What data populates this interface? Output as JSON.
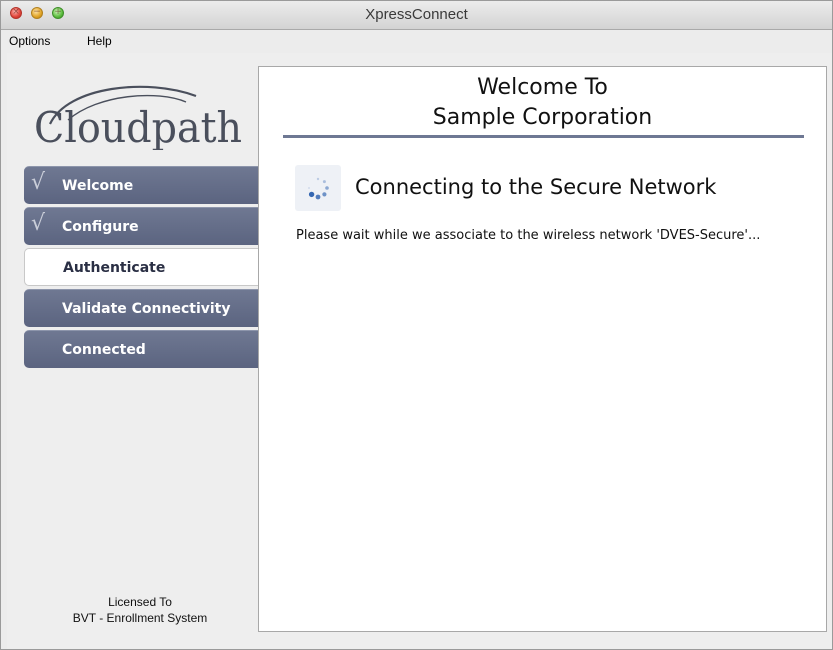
{
  "window": {
    "title": "XpressConnect",
    "controls": {
      "close_icon": "close-icon",
      "minimize_icon": "minimize-icon",
      "maximize_icon": "maximize-icon"
    }
  },
  "menu": {
    "items": [
      {
        "label": "Options"
      },
      {
        "label": "Help"
      }
    ]
  },
  "branding": {
    "logo_text": "Cloudpath"
  },
  "steps": [
    {
      "label": "Welcome",
      "status": "completed",
      "icon": "checkmark-icon"
    },
    {
      "label": "Configure",
      "status": "completed",
      "icon": "checkmark-icon"
    },
    {
      "label": "Authenticate",
      "status": "active",
      "icon": ""
    },
    {
      "label": "Validate Connectivity",
      "status": "pending",
      "icon": ""
    },
    {
      "label": "Connected",
      "status": "pending",
      "icon": ""
    }
  ],
  "license": {
    "line1": "Licensed To",
    "line2": "BVT - Enrollment System"
  },
  "content": {
    "title_line1": "Welcome To",
    "title_line2": "Sample Corporation",
    "status_icon": "loading-spinner-icon",
    "status_heading": "Connecting to the Secure Network",
    "status_text": "Please wait while we associate to the wireless network 'DVES-Secure'..."
  },
  "colors": {
    "step_background": "#5f6883",
    "active_step_background": "#ffffff",
    "accent_rule": "#6e7893",
    "spinner_blue": "#2a5fae"
  }
}
